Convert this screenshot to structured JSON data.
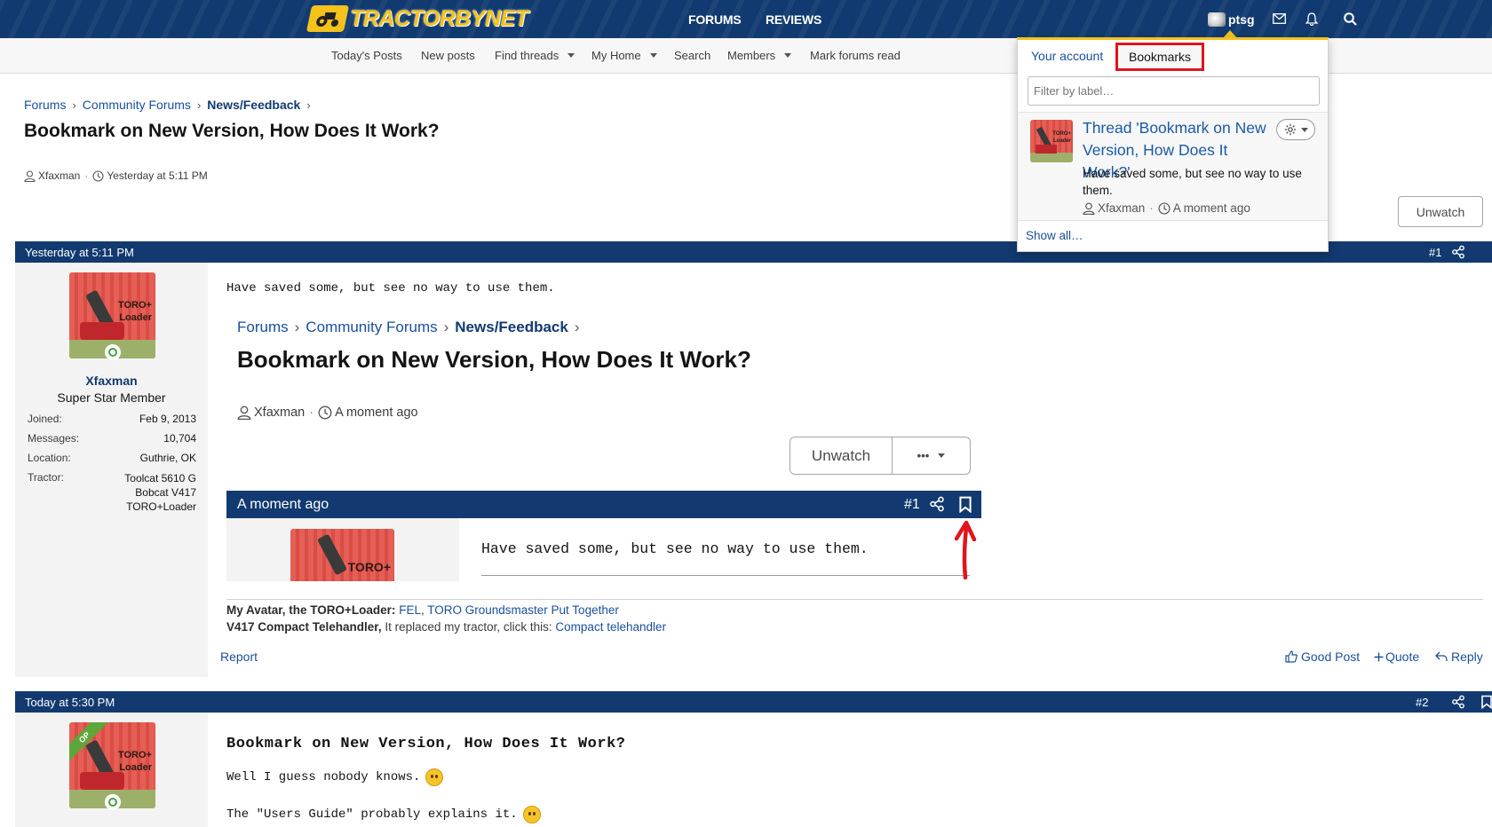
{
  "header": {
    "logo_text": "TRACTORBYNET",
    "nav": {
      "forums": "FORUMS",
      "reviews": "REVIEWS"
    },
    "user_name": "ptsg"
  },
  "subnav": {
    "todays_posts": "Today's Posts",
    "new_posts": "New posts",
    "find_threads": "Find threads",
    "my_home": "My Home",
    "search": "Search",
    "members": "Members",
    "mark_read": "Mark forums read"
  },
  "breadcrumb": {
    "forums": "Forums",
    "community": "Community Forums",
    "section": "News/Feedback"
  },
  "thread": {
    "title": "Bookmark on New Version, How Does It Work?",
    "author": "Xfaxman",
    "started": "Yesterday at 5:11 PM",
    "unwatch_label": "Unwatch"
  },
  "post1": {
    "date": "Yesterday at 5:11 PM",
    "number": "#1",
    "user": {
      "name": "Xfaxman",
      "title": "Super Star Member",
      "avatar_text": "TORO+\nLoader",
      "stats": [
        {
          "label": "Joined:",
          "value": "Feb 9, 2013"
        },
        {
          "label": "Messages:",
          "value": "10,704"
        },
        {
          "label": "Location:",
          "value": "Guthrie, OK"
        },
        {
          "label": "Tractor:",
          "value": "Toolcat 5610 G\nBobcat V417\nTORO+Loader"
        }
      ]
    },
    "text": "Have saved some, but see no way to use them.",
    "embed": {
      "crumb_forums": "Forums",
      "crumb_community": "Community Forums",
      "crumb_section": "News/Feedback",
      "title": "Bookmark on New Version, How Does It Work?",
      "author": "Xfaxman",
      "time": "A moment ago",
      "unwatch_label": "Unwatch",
      "more_label": "•••",
      "bar_date": "A moment ago",
      "bar_number": "#1",
      "avatar_text": "TORO+",
      "post_text": "Have saved some, but see no way to use them."
    },
    "signature": {
      "line1_bold": "My Avatar, the TORO+Loader:",
      "line1_link1": "FEL",
      "line1_sep": ",",
      "line1_link2": "TORO Groundsmaster Put Together",
      "line2_bold": "V417 Compact Telehandler,",
      "line2_text": "It replaced my tractor, click this:",
      "line2_link": "Compact telehandler"
    },
    "actions": {
      "report": "Report",
      "good_post": "Good Post",
      "quote": "Quote",
      "reply": "Reply"
    }
  },
  "post2": {
    "date": "Today at 5:30 PM",
    "number": "#2",
    "op_badge": "OP",
    "avatar_text": "TORO+\nLoader",
    "heading": "Bookmark on New Version, How Does It Work?",
    "line1": "Well I guess nobody knows.",
    "line2": "The \"Users Guide\" probably explains it."
  },
  "popup": {
    "tab_account": "Your account",
    "tab_bookmarks": "Bookmarks",
    "filter_placeholder": "Filter by label…",
    "avatar_text": "TORO+\nLoader",
    "item_title": "Thread 'Bookmark on New Version, How Does It Work?'",
    "item_desc": "Have saved some, but see no way to use them.",
    "item_author": "Xfaxman",
    "item_time": "A moment ago",
    "show_all": "Show all…"
  },
  "colors": {
    "header_blue": "#113a70",
    "accent_yellow": "#f3c21b",
    "highlight_red": "#e0141d",
    "link_blue": "#1a4f9c"
  }
}
